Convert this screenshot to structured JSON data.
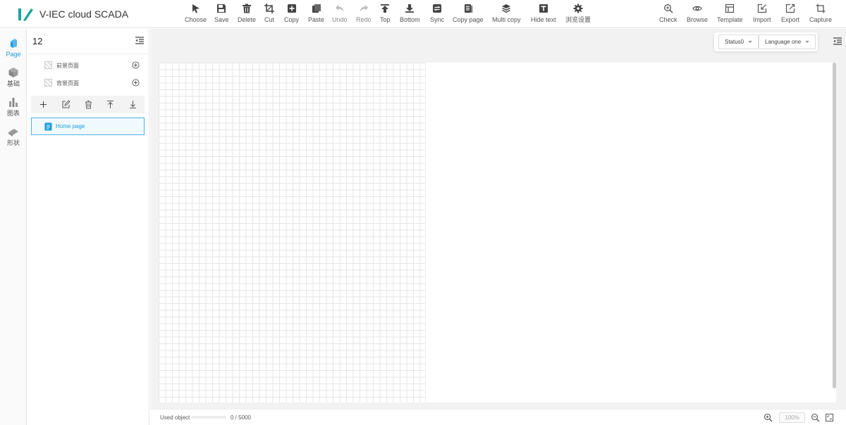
{
  "app": {
    "title": "V-IEC cloud SCADA",
    "brand_color": "#1a9bd7"
  },
  "toolbar": {
    "items": [
      {
        "label": "Choose",
        "icon": "cursor-arrow-icon"
      },
      {
        "label": "Save",
        "icon": "floppy-disk-icon"
      },
      {
        "label": "Delete",
        "icon": "trash-icon"
      },
      {
        "label": "Cut",
        "icon": "crop-icon"
      },
      {
        "label": "Copy",
        "icon": "copy-plus-icon"
      },
      {
        "label": "Paste",
        "icon": "paste-icon"
      },
      {
        "label": "Undo",
        "icon": "undo-arrow-icon",
        "disabled": true
      },
      {
        "label": "Redo",
        "icon": "redo-arrow-icon",
        "disabled": true
      },
      {
        "label": "Top",
        "icon": "arrow-to-top-icon"
      },
      {
        "label": "Bottom",
        "icon": "arrow-to-bottom-icon"
      },
      {
        "label": "Sync",
        "icon": "sync-icon"
      },
      {
        "label": "Copy page",
        "icon": "copy-page-icon"
      },
      {
        "label": "Multi copy",
        "icon": "layers-icon"
      },
      {
        "label": "Hide text",
        "icon": "text-box-icon"
      },
      {
        "label": "浏览设置",
        "icon": "gear-icon"
      }
    ],
    "right_items": [
      {
        "label": "Check",
        "icon": "zoom-check-icon"
      },
      {
        "label": "Browse",
        "icon": "eye-icon"
      },
      {
        "label": "Template",
        "icon": "template-icon"
      },
      {
        "label": "Import",
        "icon": "import-icon"
      },
      {
        "label": "Export",
        "icon": "export-icon"
      },
      {
        "label": "Capture",
        "icon": "capture-crop-icon"
      }
    ]
  },
  "rail": {
    "items": [
      {
        "label": "Page",
        "icon": "page-cube-icon",
        "active": true
      },
      {
        "label": "基础",
        "icon": "basic-cube-icon"
      },
      {
        "label": "图表",
        "icon": "bar-chart-icon"
      },
      {
        "label": "形状",
        "icon": "shape-icon"
      }
    ]
  },
  "panel": {
    "title": "12",
    "layers": [
      {
        "name": "前景页面"
      },
      {
        "name": "背景页面"
      }
    ],
    "actions": [
      "add-icon",
      "edit-icon",
      "trash-icon",
      "move-up-icon",
      "move-down-icon"
    ],
    "pages": [
      {
        "name": "Home page",
        "selected": true
      }
    ]
  },
  "canvas": {
    "status_select": "Status0",
    "language_select": "Language one"
  },
  "statusbar": {
    "used_label": "Used object",
    "used_count": "0 / 5000",
    "used_fraction": 0,
    "zoom": "100%"
  }
}
